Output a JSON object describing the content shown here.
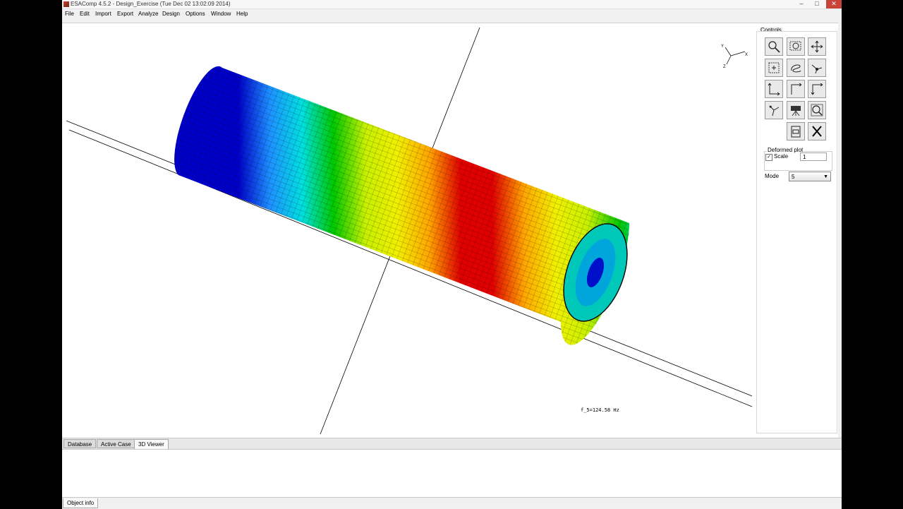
{
  "window": {
    "title": "ESAComp 4.5.2 - Design_Exercise (Tue Dec 02 13:02:09 2014)",
    "minimize": "–",
    "maximize": "□",
    "close": "✕"
  },
  "menu": [
    "File",
    "Edit",
    "Import",
    "Export",
    "Analyze",
    "Design",
    "Options",
    "Window",
    "Help"
  ],
  "viewer": {
    "frequency_label": "f_5=124.58 Hz",
    "axis_labels": {
      "y": "Y",
      "x": "X",
      "z": "Z"
    },
    "contour_colors": [
      "#0000c8",
      "#1e90ff",
      "#00e0e0",
      "#00c800",
      "#c8f000",
      "#f0f000",
      "#ffa500",
      "#e00000"
    ]
  },
  "controls": {
    "title": "Controls",
    "buttons": [
      "zoom-icon",
      "zoom-box-icon",
      "pan-icon",
      "fit-view-icon",
      "rotate-icon",
      "spin-icon",
      "view-yx-icon",
      "view-xy-icon",
      "view-xz-icon",
      "isometric-icon",
      "camera-icon",
      "magnify-icon",
      "print-icon",
      "close-view-icon"
    ],
    "deformed_plot": {
      "title": "Deformed plot",
      "scale_label": "Scale",
      "scale_checked": true,
      "scale_value": "1"
    },
    "mode": {
      "label": "Mode",
      "value": "5"
    }
  },
  "tabs": [
    "Database",
    "Active Case",
    "3D Viewer"
  ],
  "active_tab": "3D Viewer",
  "status": {
    "object_info": "Object info"
  }
}
